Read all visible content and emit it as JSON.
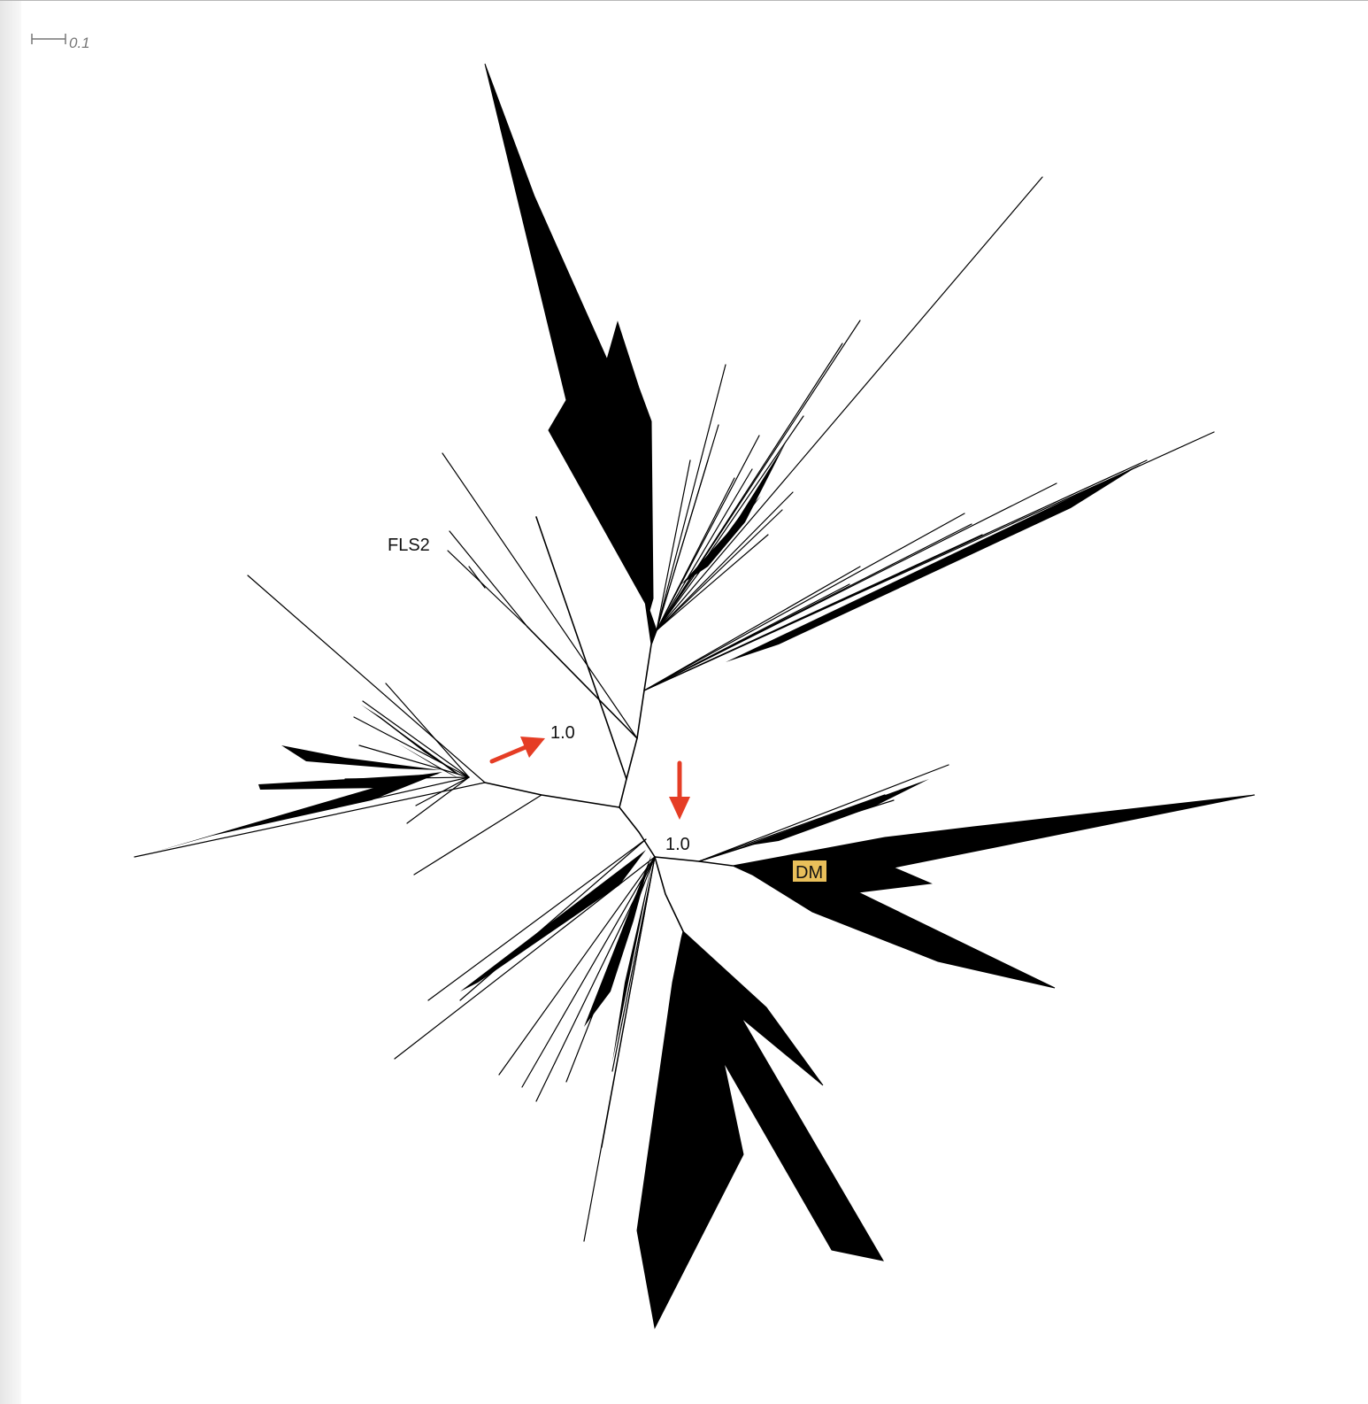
{
  "scale_bar": {
    "value_label": "0.1"
  },
  "labels": {
    "fls2": "FLS2",
    "support_left": "1.0",
    "support_right": "1.0",
    "dm": "DM"
  },
  "colors": {
    "branch": "#000000",
    "arrow": "#e53d25",
    "dm_highlight": "#e9bf5a",
    "background": "#ffffff"
  }
}
